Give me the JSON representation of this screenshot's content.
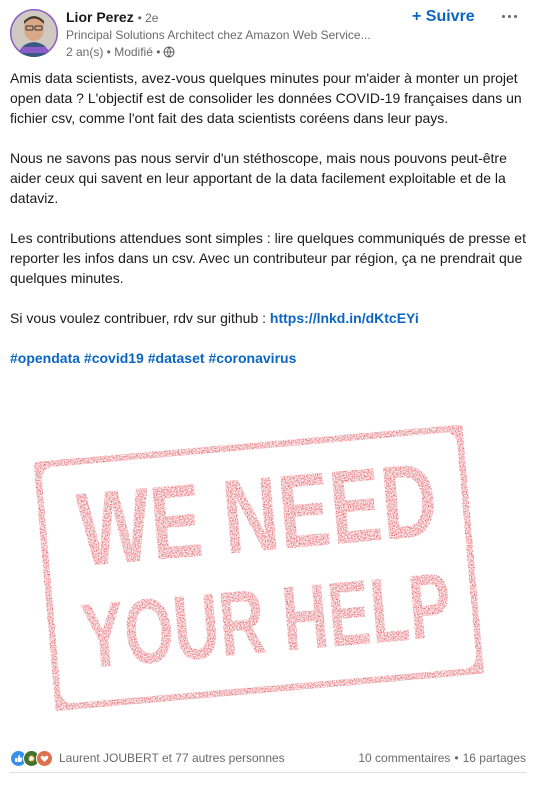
{
  "author": {
    "name": "Lior Perez",
    "degree": "• 2e",
    "headline": "Principal Solutions Architect chez Amazon Web Service...",
    "time": "2 an(s) • Modifié •"
  },
  "actions": {
    "follow_label": "+ Suivre",
    "more_icon": "ellipsis-icon"
  },
  "post": {
    "paragraphs": [
      "Amis data scientists, avez-vous quelques minutes pour m'aider à monter un projet open data ? L'objectif est de consolider les données COVID-19 françaises dans un fichier csv, comme l'ont fait des data scientists coréens dans leur pays.",
      "Nous ne savons pas nous servir d'un stéthoscope, mais nous pouvons peut-être aider ceux qui savent en leur apportant de la data facilement exploitable et de la dataviz.",
      "Les contributions attendues sont simples : lire quelques communiqués de presse et reporter les infos dans un csv. Avec un contributeur par région, ça ne prendrait que quelques minutes."
    ],
    "contribute_text": "Si vous voulez contribuer, rdv sur github : ",
    "link": "https://lnkd.in/dKtcEYi",
    "hashtags": [
      "#opendata",
      "#covid19",
      "#dataset",
      "#coronavirus"
    ]
  },
  "image": {
    "line1": "WE NEED",
    "line2": "YOUR HELP",
    "stamp_color": "#d8222c"
  },
  "social": {
    "reactions_text": "Laurent JOUBERT et 77 autres personnes",
    "comments": "10 commentaires",
    "separator": "•",
    "shares": "16 partages"
  },
  "colors": {
    "accent": "#0a66c2",
    "stamp": "#d8222c"
  }
}
